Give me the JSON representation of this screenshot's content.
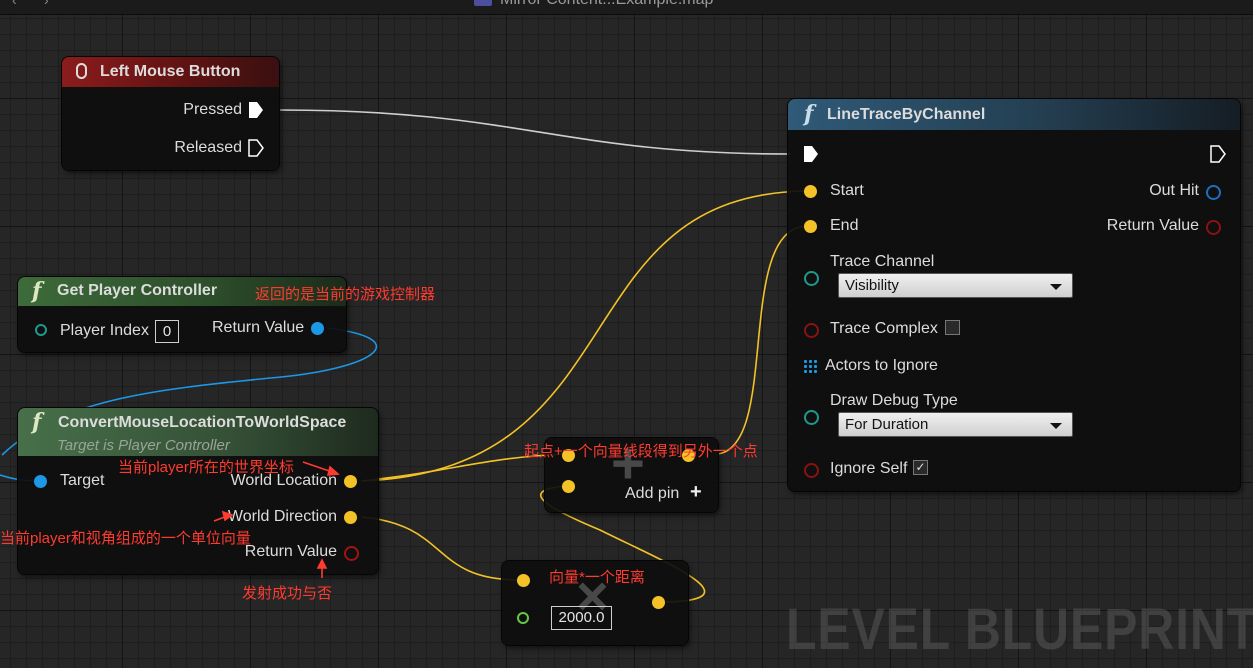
{
  "editor": {
    "map_title": "Mirror Content...Example.map",
    "watermark": "LEVEL BLUEPRINT"
  },
  "nodes": {
    "left_mouse_button": {
      "title": "Left Mouse Button",
      "icon": "mouse-icon",
      "pins": {
        "pressed": "Pressed",
        "released": "Released"
      }
    },
    "get_player_controller": {
      "title": "Get Player Controller",
      "icon": "function-icon",
      "player_index_label": "Player Index",
      "player_index_value": "0",
      "return_value_label": "Return Value"
    },
    "convert_mouse": {
      "title": "ConvertMouseLocationToWorldSpace",
      "subtitle": "Target is Player Controller",
      "icon": "function-icon",
      "target_label": "Target",
      "world_location_label": "World Location",
      "world_direction_label": "World Direction",
      "return_value_label": "Return Value"
    },
    "add_node": {
      "add_pin_label": "Add pin",
      "symbol": "+"
    },
    "multiply_node": {
      "value": "2000.0",
      "symbol": "×"
    },
    "line_trace": {
      "title": "LineTraceByChannel",
      "icon": "function-icon",
      "start_label": "Start",
      "end_label": "End",
      "trace_channel_label": "Trace Channel",
      "trace_channel_value": "Visibility",
      "trace_complex_label": "Trace Complex",
      "trace_complex_checked": false,
      "actors_to_ignore_label": "Actors to Ignore",
      "draw_debug_type_label": "Draw Debug Type",
      "draw_debug_type_value": "For Duration",
      "ignore_self_label": "Ignore Self",
      "ignore_self_checked": true,
      "out_hit_label": "Out Hit",
      "return_value_label": "Return Value"
    }
  },
  "annotations": {
    "get_controller_note": "返回的是当前的游戏控制器",
    "world_location_note": "当前player所在的世界坐标",
    "world_direction_note": "当前player和视角组成的一个单位向量",
    "return_value_note": "发射成功与否",
    "add_note": "起点+一个向量线段得到另外一个点",
    "multiply_note": "向量*一个距离"
  },
  "colors": {
    "event_header": "#8b1c1c",
    "pure_function_header": "#3d6b3a",
    "function_header": "#2f5a78",
    "vector_wire": "#f3c227",
    "object_wire": "#1c98e6",
    "exec_wire": "#d8d8d8",
    "annotation": "#ff3b30"
  }
}
